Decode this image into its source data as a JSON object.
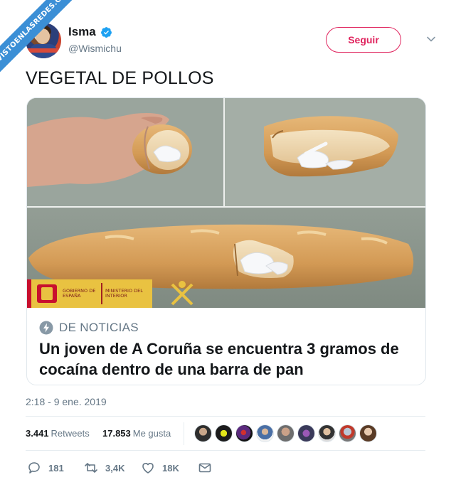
{
  "watermark": "VISTOENLASREDES.COM",
  "author": {
    "name": "Isma",
    "handle": "@Wismichu",
    "verified_icon": "verified-badge-icon"
  },
  "follow_label": "Seguir",
  "tweet_text": "VEGETAL DE POLLOS",
  "card": {
    "source": "DE NOTICIAS",
    "title": "Un joven de A Coruña se encuentra 3 gramos de cocaína dentro de una barra de pan",
    "image_text": {
      "gobierno": "GOBIERNO DE ESPAÑA",
      "ministerio": "MINISTERIO DEL INTERIOR"
    }
  },
  "timestamp": "2:18 - 9 ene. 2019",
  "stats": {
    "retweets_count": "3.441",
    "retweets_label": "Retweets",
    "likes_count": "17.853",
    "likes_label": "Me gusta"
  },
  "actions": {
    "replies": "181",
    "retweets": "3,4K",
    "likes": "18K"
  },
  "colors": {
    "accent": "#e0245e",
    "verified": "#1da1f2",
    "secondary_text": "#657786"
  }
}
